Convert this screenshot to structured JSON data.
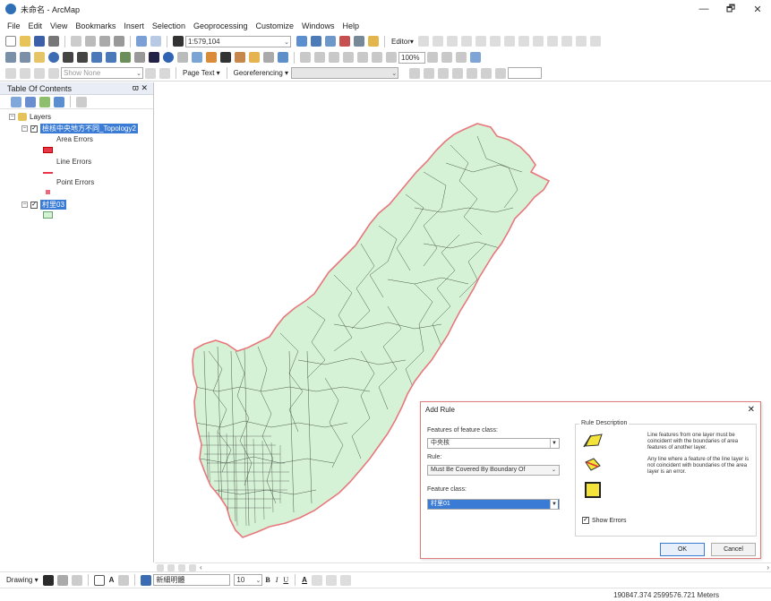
{
  "window": {
    "title": "未命名 - ArcMap",
    "controls": {
      "minimize": "—",
      "restore": "🗗",
      "close": "✕"
    }
  },
  "menu": [
    "File",
    "Edit",
    "View",
    "Bookmarks",
    "Insert",
    "Selection",
    "Geoprocessing",
    "Customize",
    "Windows",
    "Help"
  ],
  "toolbar": {
    "scale": "1:579,104",
    "editor": "Editor▾",
    "zoom_percent": "100%",
    "layer_dropdown": "Show None",
    "page_text": "Page Text ▾",
    "georeferencing": "Georeferencing ▾"
  },
  "toc": {
    "title": "Table Of Contents",
    "close": "ϖ ✕",
    "root_label": "Layers",
    "layer1": {
      "name": "檢核中央地方不同_Topology2",
      "legend": [
        "Area Errors",
        "Line Errors",
        "Point Errors"
      ]
    },
    "layer2": {
      "name": "村里03"
    }
  },
  "dialog": {
    "title": "Add Rule",
    "close": "✕",
    "features_label": "Features of feature class:",
    "features_value": "中央核",
    "rule_label": "Rule:",
    "rule_value": "Must Be Covered By Boundary Of",
    "feature_class_label": "Feature class:",
    "feature_class_value": "村里01",
    "description_title": "Rule Description",
    "description_1": "Line features from one layer must be coincident with the boundaries of area features of another layer.",
    "description_2": "Any line where a feature of the line layer is not coincident with boundaries of the area layer is an error.",
    "show_errors": "Show Errors",
    "ok": "OK",
    "cancel": "Cancel"
  },
  "drawing": {
    "label": "Drawing ▾",
    "font": "新細明體",
    "font_size": "10",
    "bold": "B",
    "italic": "I",
    "underline": "U",
    "font_color": "A"
  },
  "status": {
    "coords": "190847.374  2599576.721 Meters"
  },
  "colors": {
    "map_fill": "#d6f2d6",
    "map_outline": "#e8777c",
    "selection": "#3a7bd5"
  }
}
